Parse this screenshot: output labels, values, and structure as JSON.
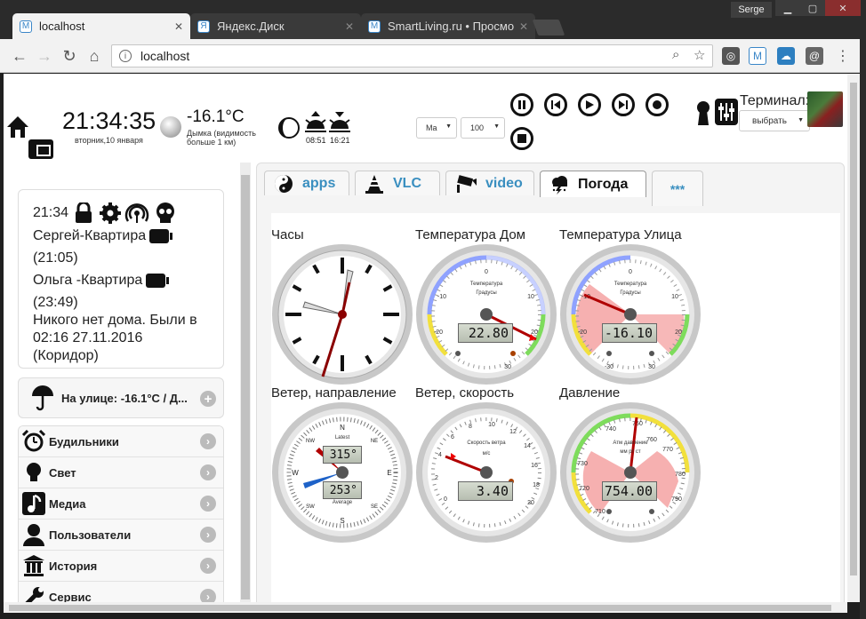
{
  "browser": {
    "tabs": [
      {
        "title": "localhost",
        "favicon": "M",
        "active": true
      },
      {
        "title": "Яндекс.Диск",
        "favicon": "Я",
        "active": false
      },
      {
        "title": "SmartLiving.ru • Просмо",
        "favicon": "M",
        "active": false
      }
    ],
    "user": "Serge",
    "url": "localhost"
  },
  "header": {
    "time": "21:34:35",
    "date": "вторник,10 января",
    "temperature": "-16.1°C",
    "weather_desc": "Дымка (видимость больше 1 км)",
    "sunrise": "08:51",
    "sunset": "16:21",
    "select1": "Ma",
    "select2": "100",
    "terminal_label": "Терминал:",
    "terminal_select": "выбрать"
  },
  "status": {
    "time": "21:34",
    "person1": "Сергей-Квартира",
    "person1_time": "(21:05)",
    "person2": "Ольга -Квартира",
    "person2_time": "(23:49)",
    "message": "Никого нет дома. Были в 02:16 27.11.2016 (Коридор)"
  },
  "outdoor": "На улице: -16.1°C / Д...",
  "menu": [
    {
      "label": "Будильники",
      "icon": "alarm-clock-icon"
    },
    {
      "label": "Свет",
      "icon": "lightbulb-icon"
    },
    {
      "label": "Медиа",
      "icon": "music-note-icon"
    },
    {
      "label": "Пользователи",
      "icon": "user-icon"
    },
    {
      "label": "История",
      "icon": "history-icon"
    },
    {
      "label": "Сервис",
      "icon": "wrench-icon"
    }
  ],
  "panel_tabs": [
    {
      "label": "apps",
      "icon": "yin-yang-icon"
    },
    {
      "label": "VLC",
      "icon": "cone-icon"
    },
    {
      "label": "video",
      "icon": "camera-icon"
    },
    {
      "label": "Погода",
      "icon": "storm-icon",
      "active": true
    },
    {
      "label": "***",
      "icon": ""
    }
  ],
  "gauges": {
    "clock": {
      "title": "Часы"
    },
    "temp_home": {
      "title": "Температура Дом",
      "value": "22.80",
      "unit_title": "Температура",
      "unit": "Градусы"
    },
    "temp_out": {
      "title": "Температура Улица",
      "value": "-16.10",
      "unit_title": "Температура",
      "unit": "Градусы"
    },
    "wind_dir": {
      "title": "Ветер, направление",
      "latest": "315°",
      "average": "253°",
      "latest_label": "Latest",
      "average_label": "Average"
    },
    "wind_speed": {
      "title": "Ветер, скорость",
      "value": "3.40",
      "unit_title": "Скорость ветра",
      "unit": "м/с"
    },
    "pressure": {
      "title": "Давление",
      "value": "754.00",
      "unit_title": "Атм давление",
      "unit": "мм рт ст"
    }
  },
  "colors": {
    "accent": "#3a8fc0",
    "alarm_zone": "#f4a0a0"
  }
}
